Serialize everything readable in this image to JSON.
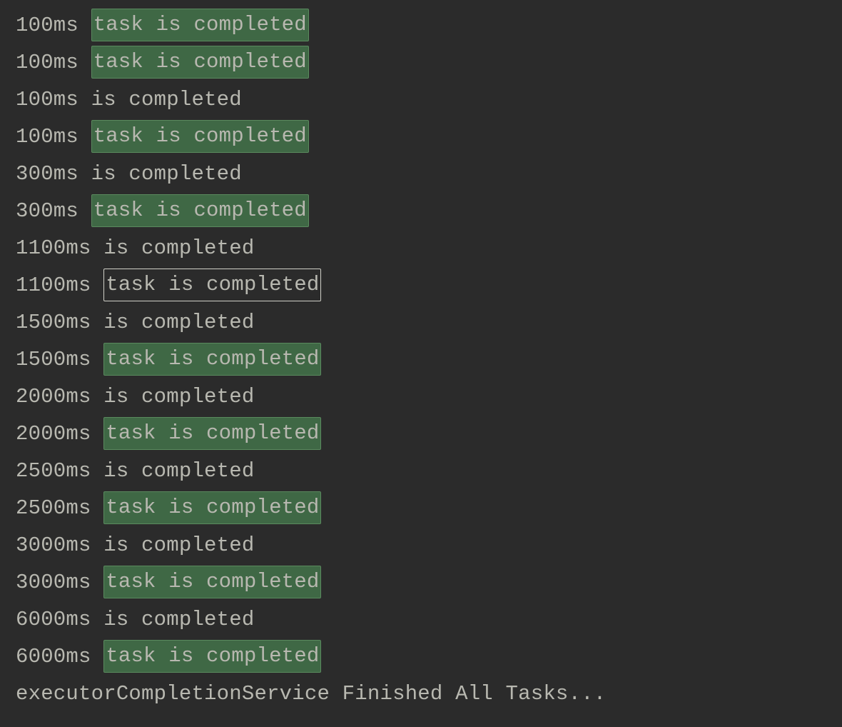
{
  "console": {
    "lines": [
      {
        "prefix": "100ms ",
        "highlight": "task is completed",
        "highlightStyle": "normal"
      },
      {
        "prefix": "100ms ",
        "highlight": "task is completed",
        "highlightStyle": "normal"
      },
      {
        "prefix": "100ms is completed"
      },
      {
        "prefix": "100ms ",
        "highlight": "task is completed",
        "highlightStyle": "normal"
      },
      {
        "prefix": "300ms is completed"
      },
      {
        "prefix": "300ms ",
        "highlight": "task is completed",
        "highlightStyle": "normal"
      },
      {
        "prefix": "1100ms is completed"
      },
      {
        "prefix": "1100ms ",
        "highlight": "task is completed",
        "highlightStyle": "selected"
      },
      {
        "prefix": "1500ms is completed"
      },
      {
        "prefix": "1500ms ",
        "highlight": "task is completed",
        "highlightStyle": "normal"
      },
      {
        "prefix": "2000ms is completed"
      },
      {
        "prefix": "2000ms ",
        "highlight": "task is completed",
        "highlightStyle": "normal"
      },
      {
        "prefix": "2500ms is completed"
      },
      {
        "prefix": "2500ms ",
        "highlight": "task is completed",
        "highlightStyle": "normal"
      },
      {
        "prefix": "3000ms is completed"
      },
      {
        "prefix": "3000ms ",
        "highlight": "task is completed",
        "highlightStyle": "normal"
      },
      {
        "prefix": "6000ms is completed"
      },
      {
        "prefix": "6000ms ",
        "highlight": "task is completed",
        "highlightStyle": "normal"
      },
      {
        "prefix": "executorCompletionService Finished All Tasks..."
      }
    ]
  }
}
